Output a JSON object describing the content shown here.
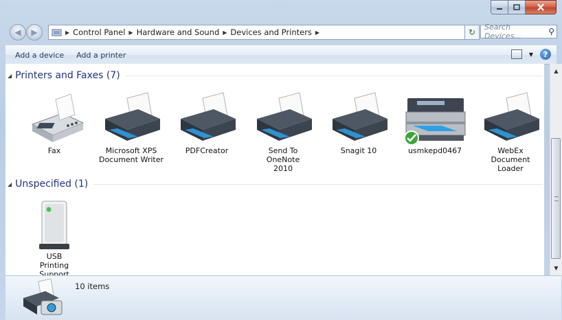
{
  "window": {
    "caption": {
      "minimize": "–",
      "maximize": "□",
      "close": "✕"
    }
  },
  "nav": {
    "back_icon": "back-arrow-icon",
    "forward_icon": "forward-arrow-icon",
    "breadcrumbs": [
      "Control Panel",
      "Hardware and Sound",
      "Devices and Printers"
    ],
    "search_placeholder": "Search Devices..."
  },
  "commands": {
    "add_device": "Add a device",
    "add_printer": "Add a printer"
  },
  "groups": [
    {
      "title": "Printers and Faxes (7)",
      "items": [
        {
          "label": "Fax",
          "icon": "fax-icon"
        },
        {
          "label": "Microsoft XPS Document Writer",
          "icon": "printer-icon"
        },
        {
          "label": "PDFCreator",
          "icon": "printer-icon"
        },
        {
          "label": "Send To OneNote 2010",
          "icon": "printer-icon"
        },
        {
          "label": "Snagit 10",
          "icon": "printer-icon"
        },
        {
          "label": "usmkepd0467",
          "icon": "multifunction-printer-icon",
          "default": true
        },
        {
          "label": "WebEx Document Loader",
          "icon": "printer-icon"
        }
      ]
    },
    {
      "title": "Unspecified (1)",
      "items": [
        {
          "label": "USB Printing Support",
          "icon": "usb-device-icon"
        }
      ]
    }
  ],
  "details": {
    "count": "10 items",
    "icon": "devices-printers-icon"
  },
  "colors": {
    "group_title": "#1e3287",
    "command_text": "#1e3a5f",
    "close_button": "#c3422a"
  }
}
